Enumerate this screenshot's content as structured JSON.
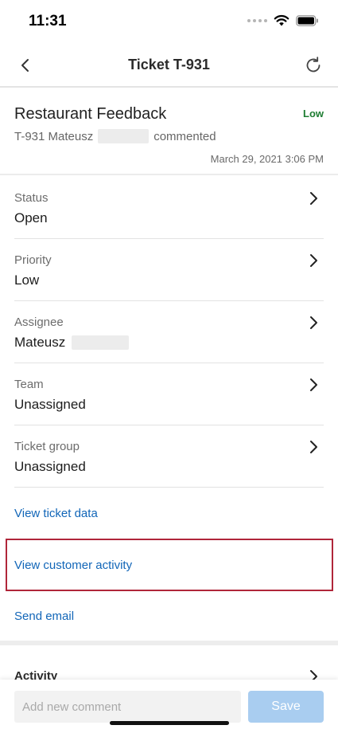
{
  "status_bar": {
    "time": "11:31"
  },
  "nav": {
    "title": "Ticket T-931"
  },
  "ticket": {
    "title": "Restaurant Feedback",
    "priority_badge": "Low",
    "sub_id_name": "T-931 Mateusz",
    "sub_action": "commented",
    "date": "March 29, 2021 3:06 PM"
  },
  "fields": [
    {
      "label": "Status",
      "value": "Open"
    },
    {
      "label": "Priority",
      "value": "Low"
    },
    {
      "label": "Assignee",
      "value": "Mateusz"
    },
    {
      "label": "Team",
      "value": "Unassigned"
    },
    {
      "label": "Ticket group",
      "value": "Unassigned"
    }
  ],
  "links": {
    "view_ticket_data": "View ticket data",
    "view_customer_activity": "View customer activity",
    "send_email": "Send email"
  },
  "activity": {
    "label": "Activity"
  },
  "comment": {
    "placeholder": "Add new comment",
    "save_label": "Save"
  },
  "colors": {
    "link": "#1266b8",
    "priority_low": "#1e7d32",
    "highlight": "#b0263a",
    "save_disabled": "#a9cdf0"
  },
  "icons": {
    "back": "chevron-left-icon",
    "refresh": "refresh-icon",
    "row_chevron": "chevron-right-icon",
    "wifi": "wifi-icon",
    "battery": "battery-icon",
    "signal": "signal-icon"
  }
}
